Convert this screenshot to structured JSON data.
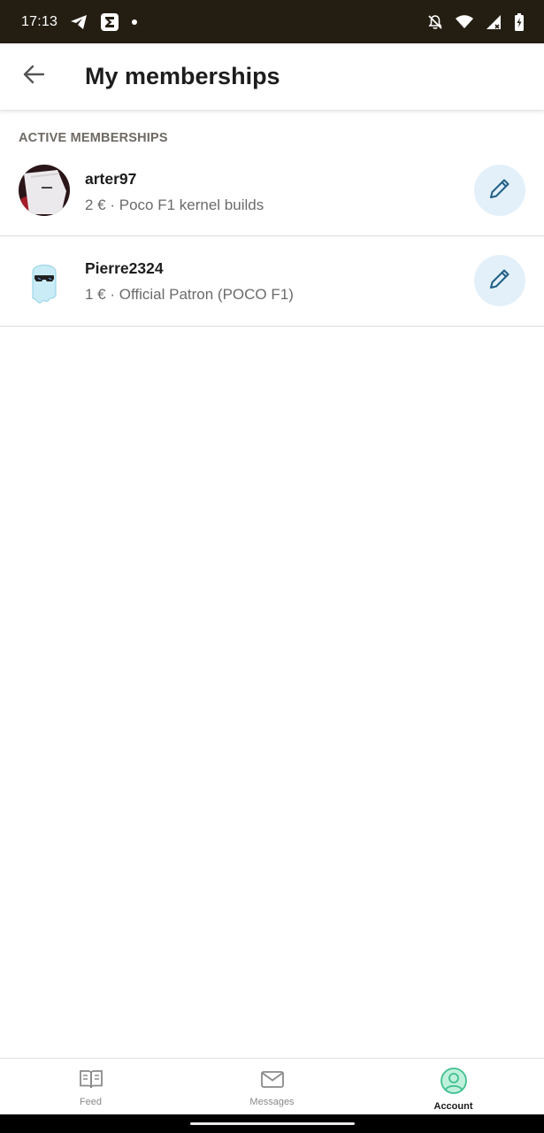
{
  "status_bar": {
    "time": "17:13",
    "left_icons": [
      "telegram-icon",
      "sigma-app-icon",
      "notification-dot-icon"
    ],
    "right_icons": [
      "notifications-off-icon",
      "wifi-icon",
      "cellular-signal-icon",
      "battery-charging-icon"
    ]
  },
  "app_bar": {
    "back_icon": "arrow-left-icon",
    "title": "My memberships"
  },
  "section": {
    "header": "ACTIVE MEMBERSHIPS"
  },
  "memberships": [
    {
      "creator": "arter97",
      "tier": "2 € · Poco F1 kernel builds",
      "edit_icon": "pencil-icon"
    },
    {
      "creator": "Pierre2324",
      "tier": "1 € · Official Patron (POCO F1)",
      "edit_icon": "pencil-icon"
    }
  ],
  "bottom_nav": {
    "items": [
      {
        "label": "Feed",
        "icon": "open-book-icon",
        "active": false
      },
      {
        "label": "Messages",
        "icon": "envelope-icon",
        "active": false
      },
      {
        "label": "Account",
        "icon": "user-circle-icon",
        "active": true
      }
    ]
  },
  "colors": {
    "status_bar_bg": "#241d12",
    "edit_button_bg": "#e3f0fa",
    "edit_icon": "#1f5f86",
    "account_active": "#3fbf8f",
    "nav_inactive": "#8a8a8a"
  }
}
